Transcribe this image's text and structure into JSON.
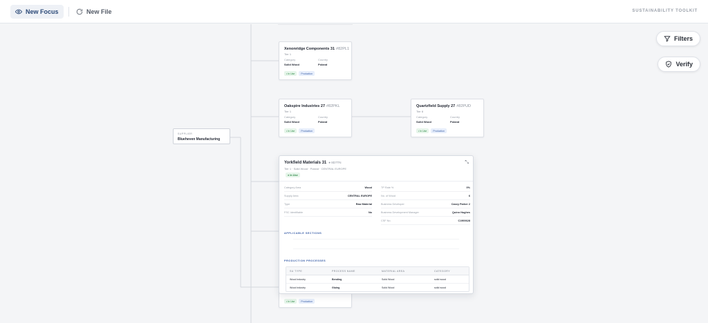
{
  "topbar": {
    "new_focus": "New Focus",
    "new_file": "New File",
    "brand": "SUSTAINABILITY TOOLKIT"
  },
  "floating": {
    "filters": "Filters",
    "verify": "Verify"
  },
  "supplier": {
    "label": "SUPPLIER",
    "name": "Blueheven Manufacturing"
  },
  "cards": [
    {
      "name": "Xenonridge Components 31",
      "code": "#82PL1",
      "tier": "Tier 1",
      "category_label": "Category",
      "category": "Solid Wood",
      "country_label": "Country",
      "country": "Poland",
      "tag_use": "• In Use",
      "tag_prod": "Production"
    },
    {
      "name": "Oakspire Industries 27",
      "code": "#82PKL",
      "tier": "Tier 1",
      "category_label": "Category",
      "category": "Solid Wood",
      "country_label": "Country",
      "country": "Poland",
      "tag_use": "• In Use",
      "tag_prod": "Production"
    },
    {
      "name": "Quartzfield Supply 27",
      "code": "#82PUD",
      "tier": "Tier 8",
      "category_label": "Category",
      "category": "Solid Wood",
      "country_label": "Country",
      "country": "Poland",
      "tag_use": "• In Use",
      "tag_prod": "Production"
    }
  ],
  "bottom_card_tags": {
    "use": "• In Use",
    "prod": "Production"
  },
  "detail": {
    "title": "Yorkfield Materials 31",
    "code": "● 8D7TN",
    "subtitle": "Tier 1 · Solid Wood · Poland · CENTRAL EUROPE",
    "status": "● In Use",
    "close": "⤡",
    "left_rows": [
      {
        "k": "Category Area",
        "v": "Wood"
      },
      {
        "k": "Supply Area",
        "v": "CENTRAL EUROPE"
      },
      {
        "k": "Type",
        "v": "Raw Material"
      },
      {
        "k": "FSC Identifiable",
        "v": "No"
      }
    ],
    "right_rows": [
      {
        "k": "TP Rate %",
        "v": "0%"
      },
      {
        "k": "No. of Wood",
        "v": "6"
      },
      {
        "k": "Business Developer",
        "v": "Casey Parker 2"
      },
      {
        "k": "Business Development Manager",
        "v": "Quinn Hughes"
      },
      {
        "k": "CSF No.",
        "v": "C1900628"
      }
    ],
    "applicable_sections": "APPLICABLE SECTIONS",
    "production_processes": "PRODUCTION PROCESSES",
    "table": {
      "headers": [
        "SU TYPE",
        "PROCESS NAME",
        "MATERIAL AREA",
        "CATEGORY"
      ],
      "rows": [
        [
          "Wood industry",
          "Bending",
          "Solid Wood",
          "solid wood"
        ],
        [
          "Wood industry",
          "Gluing",
          "Solid Wood",
          "solid wood"
        ]
      ]
    }
  }
}
